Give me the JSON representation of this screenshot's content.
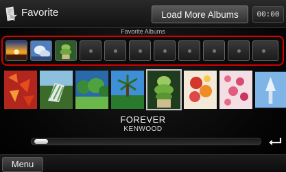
{
  "header": {
    "title": "Favorite",
    "icon": "favorite-folder-icon",
    "load_more_label": "Load More Albums",
    "clock": "00:00"
  },
  "favorites": {
    "label": "Favorite Albums",
    "highlight_color": "#d40000",
    "slots": [
      {
        "state": "filled",
        "art": "sunset"
      },
      {
        "state": "filled",
        "art": "sky"
      },
      {
        "state": "filled",
        "art": "plant"
      },
      {
        "state": "empty"
      },
      {
        "state": "empty"
      },
      {
        "state": "empty"
      },
      {
        "state": "empty"
      },
      {
        "state": "empty"
      },
      {
        "state": "empty"
      },
      {
        "state": "empty"
      },
      {
        "state": "empty"
      }
    ]
  },
  "albums": [
    {
      "art": "red-leaves"
    },
    {
      "art": "deck-chair"
    },
    {
      "art": "trees"
    },
    {
      "art": "palm-sky"
    },
    {
      "art": "plant",
      "selected": true
    },
    {
      "art": "flowers"
    },
    {
      "art": "pink-blossom"
    },
    {
      "art": "blue-tree"
    }
  ],
  "now": {
    "title": "FOREVER",
    "artist": "KENWOOD"
  },
  "scroll": {
    "position": 0.06
  },
  "footer": {
    "menu_label": "Menu",
    "return_icon": "return-icon"
  }
}
